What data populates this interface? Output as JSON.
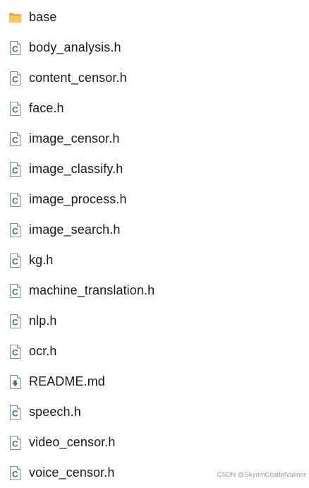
{
  "files": [
    {
      "name": "base",
      "icon": "folder-icon"
    },
    {
      "name": "body_analysis.h",
      "icon": "c-header-file-icon"
    },
    {
      "name": "content_censor.h",
      "icon": "c-header-file-icon"
    },
    {
      "name": "face.h",
      "icon": "c-header-file-icon"
    },
    {
      "name": "image_censor.h",
      "icon": "c-header-file-icon"
    },
    {
      "name": "image_classify.h",
      "icon": "c-header-file-icon"
    },
    {
      "name": "image_process.h",
      "icon": "c-header-file-icon"
    },
    {
      "name": "image_search.h",
      "icon": "c-header-file-icon"
    },
    {
      "name": "kg.h",
      "icon": "c-header-file-icon"
    },
    {
      "name": "machine_translation.h",
      "icon": "c-header-file-icon"
    },
    {
      "name": "nlp.h",
      "icon": "c-header-file-icon"
    },
    {
      "name": "ocr.h",
      "icon": "c-header-file-icon"
    },
    {
      "name": "README.md",
      "icon": "markdown-file-icon"
    },
    {
      "name": "speech.h",
      "icon": "c-header-file-icon"
    },
    {
      "name": "video_censor.h",
      "icon": "c-header-file-icon"
    },
    {
      "name": "voice_censor.h",
      "icon": "c-header-file-icon"
    }
  ],
  "watermark": "CSDN @SkyrimCitadelValinor",
  "colors": {
    "folder": "#f5c04a",
    "folder_dark": "#e3a52c",
    "file_border": "#7a8a99",
    "c_letter": "#2f6d9e",
    "md_arrow": "#2f6d9e"
  }
}
